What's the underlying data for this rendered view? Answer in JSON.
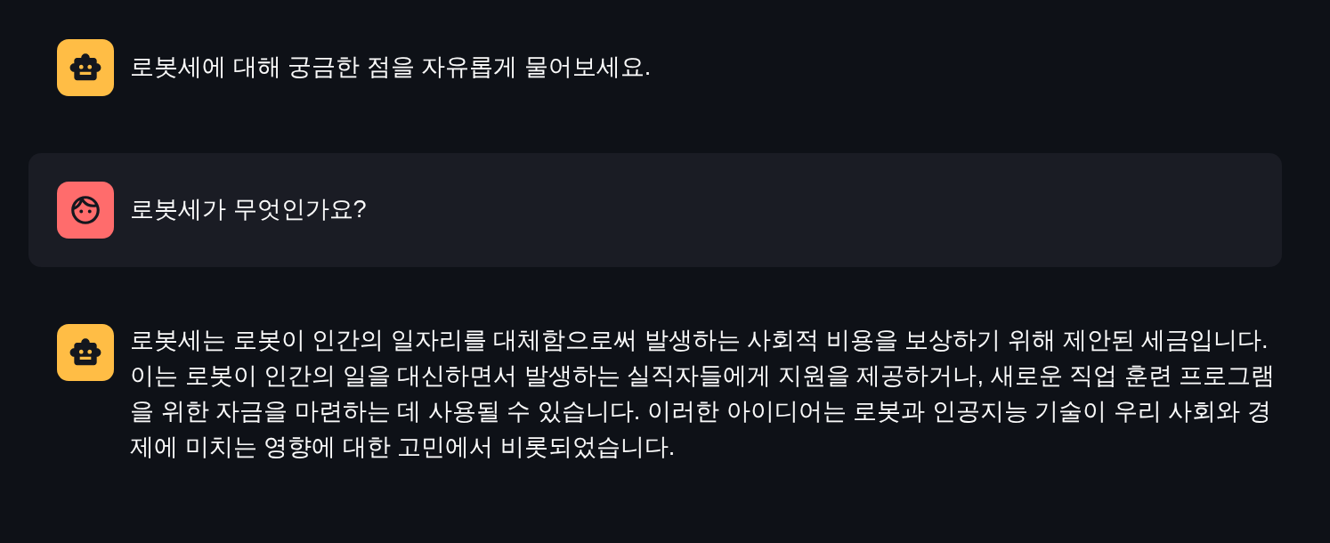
{
  "messages": [
    {
      "kind": "assistant",
      "text": "로봇세에 대해 궁금한 점을 자유롭게 물어보세요."
    },
    {
      "kind": "user",
      "text": "로봇세가 무엇인가요?"
    },
    {
      "kind": "assistant",
      "text": "로봇세는 로봇이 인간의 일자리를 대체함으로써 발생하는 사회적 비용을 보상하기 위해 제안된 세금입니다. 이는 로봇이 인간의 일을 대신하면서 발생하는 실직자들에게 지원을 제공하거나, 새로운 직업 훈련 프로그램을 위한 자금을 마련하는 데 사용될 수 있습니다. 이러한 아이디어는 로봇과 인공지능 기술이 우리 사회와 경제에 미치는 영향에 대한 고민에서 비롯되었습니다."
    }
  ]
}
